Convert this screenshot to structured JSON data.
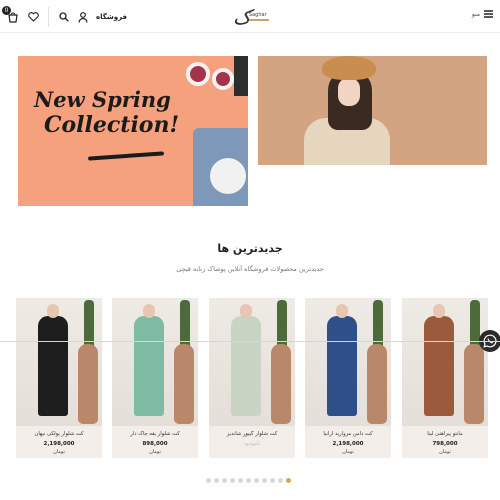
{
  "header": {
    "menu_label": "منو",
    "shop_label": "فروشگاه",
    "cart_count": "0",
    "logo_script": "ک",
    "logo_name": "Saghar",
    "icons": [
      "hamburger-menu-icon",
      "user-icon",
      "search-icon",
      "heart-icon",
      "cart-icon"
    ]
  },
  "banners": {
    "left": {
      "line1": "New Spring",
      "line2": "Collection!"
    }
  },
  "section": {
    "title": "جدیدترین ها",
    "subtitle": "جدیدترین محصولات فروشگاه آنلاین پوشاک زنانه قیچی"
  },
  "products": [
    {
      "name": "مانتو پیراهنی لینا",
      "price": "798,000",
      "currency": "تومان",
      "available": true
    },
    {
      "name": "کت دامن مروارید آرانیا",
      "price": "2,198,000",
      "currency": "تومان",
      "available": true
    },
    {
      "name": "کت شلوار گیپور شاندیز",
      "price": "",
      "currency": "",
      "available": false,
      "status": "ناموجود"
    },
    {
      "name": "کت شلوار یقه چاک دار",
      "price": "898,000",
      "currency": "تومان",
      "available": true
    },
    {
      "name": "کت شلوار پولکی نیهان",
      "price": "2,198,000",
      "currency": "تومان",
      "available": true
    }
  ],
  "carousel": {
    "dot_count": 11,
    "active_index": 10
  },
  "colors": {
    "accent": "#d9a253",
    "banner_peach": "#f6a17e",
    "card_bg": "#f3eee9"
  }
}
